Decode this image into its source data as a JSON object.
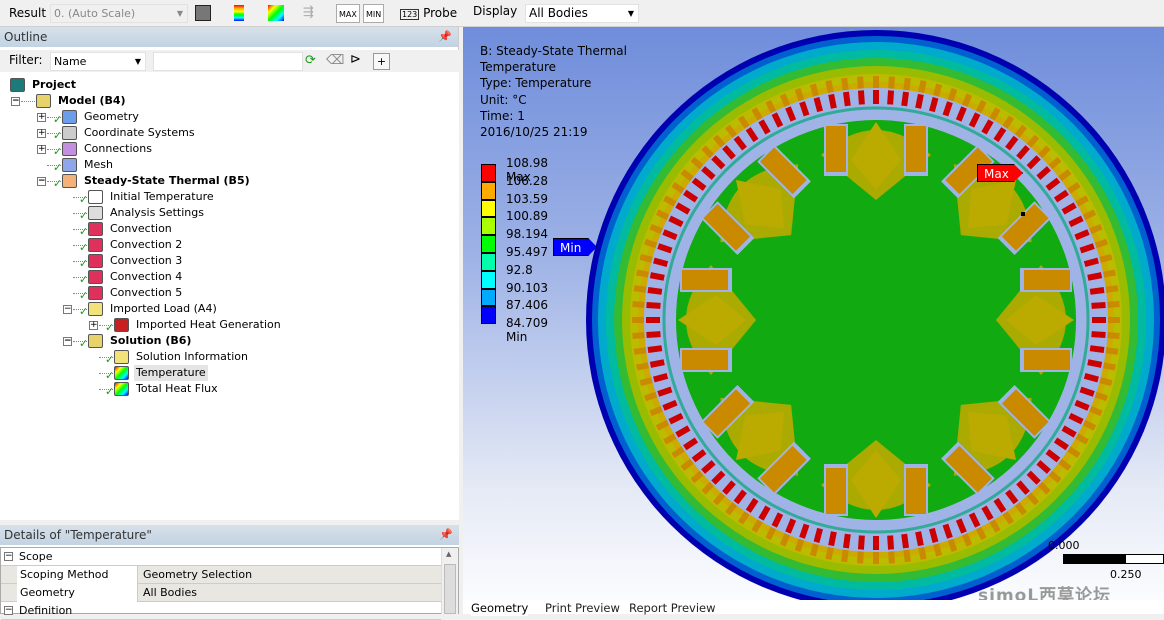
{
  "toolbar": {
    "result_label": "Result",
    "scale_value": "0. (Auto Scale)",
    "max_label": "MAX",
    "min_label": "MIN",
    "probe_label": "Probe",
    "display_label": "Display",
    "display_value": "All Bodies"
  },
  "outline": {
    "title": "Outline",
    "filter_label": "Filter:",
    "filter_value": "Name",
    "search_value": ""
  },
  "tree": [
    {
      "label": "Project",
      "level": 0,
      "bold": true,
      "icon": "project-icon",
      "exp": "",
      "check": false
    },
    {
      "label": "Model (B4)",
      "level": 1,
      "bold": true,
      "icon": "model-icon",
      "exp": "-",
      "check": false
    },
    {
      "label": "Geometry",
      "level": 2,
      "bold": false,
      "icon": "geometry-icon",
      "exp": "+",
      "check": true
    },
    {
      "label": "Coordinate Systems",
      "level": 2,
      "bold": false,
      "icon": "coordinate-systems-icon",
      "exp": "+",
      "check": true
    },
    {
      "label": "Connections",
      "level": 2,
      "bold": false,
      "icon": "connections-icon",
      "exp": "+",
      "check": true
    },
    {
      "label": "Mesh",
      "level": 2,
      "bold": false,
      "icon": "mesh-icon",
      "exp": "",
      "check": true
    },
    {
      "label": "Steady-State Thermal (B5)",
      "level": 2,
      "bold": true,
      "icon": "analysis-folder-icon",
      "exp": "-",
      "check": true
    },
    {
      "label": "Initial Temperature",
      "level": 3,
      "bold": false,
      "icon": "initial-temperature-icon",
      "exp": "",
      "check": true
    },
    {
      "label": "Analysis Settings",
      "level": 3,
      "bold": false,
      "icon": "analysis-settings-icon",
      "exp": "",
      "check": true
    },
    {
      "label": "Convection",
      "level": 3,
      "bold": false,
      "icon": "convection-icon",
      "exp": "",
      "check": true
    },
    {
      "label": "Convection 2",
      "level": 3,
      "bold": false,
      "icon": "convection-icon",
      "exp": "",
      "check": true
    },
    {
      "label": "Convection 3",
      "level": 3,
      "bold": false,
      "icon": "convection-icon",
      "exp": "",
      "check": true
    },
    {
      "label": "Convection 4",
      "level": 3,
      "bold": false,
      "icon": "convection-icon",
      "exp": "",
      "check": true
    },
    {
      "label": "Convection 5",
      "level": 3,
      "bold": false,
      "icon": "convection-icon",
      "exp": "",
      "check": true
    },
    {
      "label": "Imported Load (A4)",
      "level": 3,
      "bold": false,
      "icon": "imported-load-icon",
      "exp": "-",
      "check": true
    },
    {
      "label": "Imported Heat Generation",
      "level": 4,
      "bold": false,
      "icon": "imported-heat-generation-icon",
      "exp": "+",
      "check": true
    },
    {
      "label": "Solution (B6)",
      "level": 3,
      "bold": true,
      "icon": "solution-icon",
      "exp": "-",
      "check": true
    },
    {
      "label": "Solution Information",
      "level": 4,
      "bold": false,
      "icon": "solution-information-icon",
      "exp": "",
      "check": true
    },
    {
      "label": "Temperature",
      "level": 4,
      "bold": false,
      "icon": "temperature-result-icon",
      "exp": "",
      "check": true,
      "selected": true
    },
    {
      "label": "Total Heat Flux",
      "level": 4,
      "bold": false,
      "icon": "heat-flux-result-icon",
      "exp": "",
      "check": true
    }
  ],
  "details": {
    "title": "Details of \"Temperature\"",
    "scope_label": "Scope",
    "rows": [
      {
        "key": "Scoping Method",
        "value": "Geometry Selection"
      },
      {
        "key": "Geometry",
        "value": "All Bodies"
      }
    ],
    "definition_label": "Definition"
  },
  "viewport": {
    "info": [
      "B: Steady-State Thermal",
      "Temperature",
      "Type: Temperature",
      "Unit: °C",
      "Time: 1",
      "2016/10/25 21:19"
    ],
    "legend": {
      "labels": [
        "108.98 Max",
        "106.28",
        "103.59",
        "100.89",
        "98.194",
        "95.497",
        "92.8",
        "90.103",
        "87.406",
        "84.709 Min"
      ],
      "colors": [
        "#ff0000",
        "#ffaa00",
        "#ffff00",
        "#aaff00",
        "#00ff00",
        "#00ffaa",
        "#00ffff",
        "#00aaff",
        "#0000ff"
      ]
    },
    "max_flag": "Max",
    "min_flag": "Min",
    "scale_start": "0.000",
    "scale_end": "0.250",
    "watermark": "simoL西莫论坛"
  },
  "tabs": [
    "Geometry",
    "Print Preview",
    "Report Preview"
  ]
}
